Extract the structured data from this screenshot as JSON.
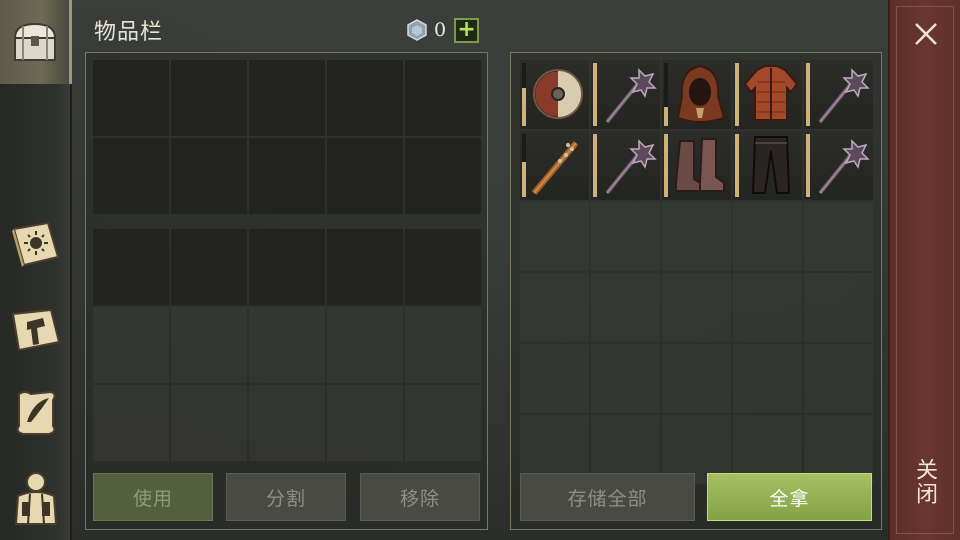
{
  "header": {
    "title": "物品栏",
    "currency_value": "0",
    "add_label": "+"
  },
  "left_rail": {
    "tabs": [
      {
        "name": "chest-icon",
        "active": true
      },
      {
        "name": "book-sun-icon",
        "active": false
      },
      {
        "name": "crafting-hammer-icon",
        "active": false
      },
      {
        "name": "quill-scroll-icon",
        "active": false
      },
      {
        "name": "backpack-character-icon",
        "active": false
      }
    ]
  },
  "inventory": {
    "bag_rows": 2,
    "bag_cols": 5,
    "quick_rows": 3,
    "quick_cols": 5
  },
  "loot": {
    "items": [
      {
        "name": "round-shield",
        "durability": 0.6
      },
      {
        "name": "spiked-mace",
        "durability": 1.0
      },
      {
        "name": "leather-hood",
        "durability": 0.3
      },
      {
        "name": "padded-jacket",
        "durability": 1.0
      },
      {
        "name": "spiked-mace",
        "durability": 1.0
      },
      {
        "name": "nail-club",
        "durability": 0.55
      },
      {
        "name": "spiked-mace",
        "durability": 1.0
      },
      {
        "name": "leather-boots",
        "durability": 1.0
      },
      {
        "name": "leather-pants",
        "durability": 1.0
      },
      {
        "name": "spiked-mace",
        "durability": 1.0
      }
    ],
    "total_slots": 30
  },
  "buttons": {
    "use": "使用",
    "split": "分割",
    "remove": "移除",
    "store_all": "存储全部",
    "take_all": "全拿"
  },
  "close": {
    "label": "关闭"
  },
  "colors": {
    "accent_green": "#a6c061",
    "close_red": "#6a3630",
    "panel_border": "#7b7860"
  }
}
